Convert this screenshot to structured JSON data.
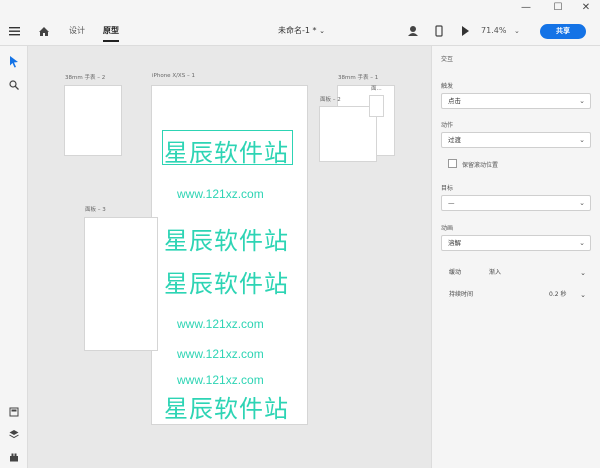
{
  "window": {
    "minimize": "—",
    "maximize": "☐",
    "close": "✕"
  },
  "toolbar": {
    "tabs": [
      {
        "label": "设计"
      },
      {
        "label": "原型"
      }
    ],
    "doc_title": "未命名-1 *",
    "zoom": "71.4%",
    "share": "共享"
  },
  "canvas": {
    "artboards": [
      {
        "label": "38mm 手表 – 2"
      },
      {
        "label": "iPhone X/XS – 1"
      },
      {
        "label": "38mm 手表 – 1"
      },
      {
        "label": "面板 – 2"
      },
      {
        "label": "面..."
      },
      {
        "label": "面板 – 3"
      }
    ],
    "watermark_cn": "星辰软件站",
    "watermark_url": "www.121xz.com"
  },
  "panel": {
    "title": "交互",
    "trigger": {
      "label": "触发",
      "value": "点击"
    },
    "action": {
      "label": "动作",
      "value": "过渡"
    },
    "preserve_scroll": "保留滚动位置",
    "target": {
      "label": "目标",
      "value": "—"
    },
    "animation": {
      "label": "动画",
      "value": "溶解"
    },
    "easing": {
      "label": "缓动",
      "value": "渐入"
    },
    "duration": {
      "label": "持续时间",
      "value": "0.2 秒"
    }
  },
  "colors": {
    "accent": "#1473e6",
    "watermark": "#2dd4b4"
  }
}
